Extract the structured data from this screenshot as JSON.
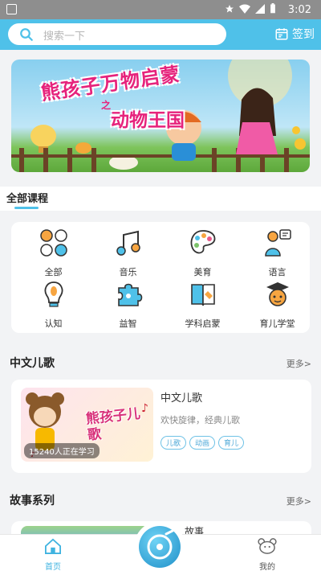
{
  "status_bar": {
    "time": "3:02"
  },
  "header": {
    "search_placeholder": "搜索一下",
    "signin_label": "签到",
    "search_icon": "search-icon",
    "signin_icon": "calendar-icon"
  },
  "banner": {
    "title": "熊孩子万物启蒙",
    "subtitle_prefix": "之",
    "subtitle": "动物王国"
  },
  "all_courses": {
    "title": "全部课程",
    "categories": [
      {
        "label": "全部",
        "icon": "clover-icon"
      },
      {
        "label": "音乐",
        "icon": "music-note-icon"
      },
      {
        "label": "美育",
        "icon": "palette-icon"
      },
      {
        "label": "语言",
        "icon": "speech-icon"
      },
      {
        "label": "认知",
        "icon": "lightbulb-icon"
      },
      {
        "label": "益智",
        "icon": "puzzle-icon"
      },
      {
        "label": "学科启蒙",
        "icon": "book-icon"
      },
      {
        "label": "育儿学堂",
        "icon": "graduate-icon"
      }
    ]
  },
  "chinese_songs": {
    "title": "中文儿歌",
    "more": "更多>",
    "card": {
      "title": "中文儿歌",
      "desc": "欢快旋律，经典儿歌",
      "learning": "15240人正在学习",
      "thumb_text": "熊孩子儿歌",
      "tags": [
        "儿歌",
        "动画",
        "育儿"
      ]
    }
  },
  "stories": {
    "title": "故事系列",
    "more": "更多>",
    "card": {
      "title": "故事"
    }
  },
  "tabbar": {
    "home": "首页",
    "mine": "我的"
  },
  "colors": {
    "accent": "#4fc1e9",
    "banner_title": "#e6237c"
  }
}
